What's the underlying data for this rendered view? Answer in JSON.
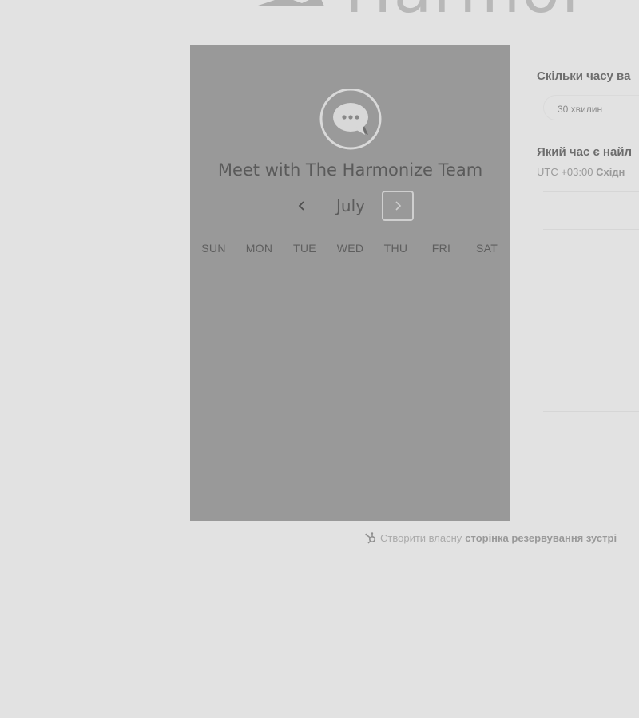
{
  "header": {
    "brand_partial": "Harmoi"
  },
  "calendar_panel": {
    "title": "Meet with The Harmonize Team",
    "month": "July",
    "weekdays": [
      "SUN",
      "MON",
      "TUE",
      "WED",
      "THU",
      "FRI",
      "SAT"
    ],
    "icons": {
      "avatar": "chat-bubble-icon",
      "prev": "chevron-left-icon",
      "next": "chevron-right-icon"
    }
  },
  "booking_panel": {
    "duration_question": "Скільки часу ва",
    "duration_option": "30 хвилин",
    "time_question": "Який час є найл",
    "timezone_label": "UTC +03:00",
    "timezone_name": "Східн"
  },
  "footer": {
    "link_prefix": "Створити власну",
    "link_bold": "сторінка резервування зустрі"
  },
  "colors": {
    "page_bg": "#e2e2e2",
    "panel_bg": "#999999",
    "text_dark": "#5a5a5a",
    "text_muted": "#aaaaaa"
  }
}
